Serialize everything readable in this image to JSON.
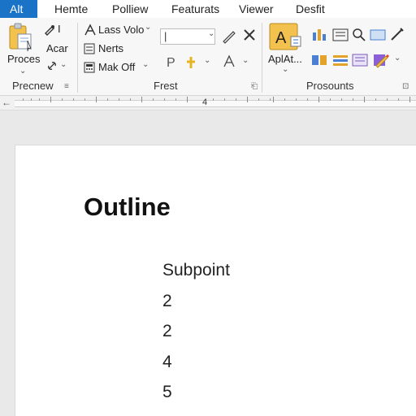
{
  "tabs": [
    "Alt",
    "Hemte",
    "Polliew",
    "Featurats",
    "Viewer",
    "Desfit"
  ],
  "ribbon": {
    "group1": {
      "paste_label": "Proces",
      "acar_label": "Acar",
      "cursor_char": "I",
      "label": "Precnew"
    },
    "group2": {
      "font_label": "Lass Volo",
      "nerts_label": "Nerts",
      "mak_label": "Mak Off",
      "label": "Frest",
      "p_label": "P"
    },
    "group3": {
      "apl_label": "AplAt...",
      "label": "Prosounts"
    }
  },
  "ruler": {
    "marker": "4"
  },
  "document": {
    "title": "Outline",
    "subpoint": "Subpoint",
    "items": [
      "2",
      "2",
      "4",
      "5"
    ]
  }
}
